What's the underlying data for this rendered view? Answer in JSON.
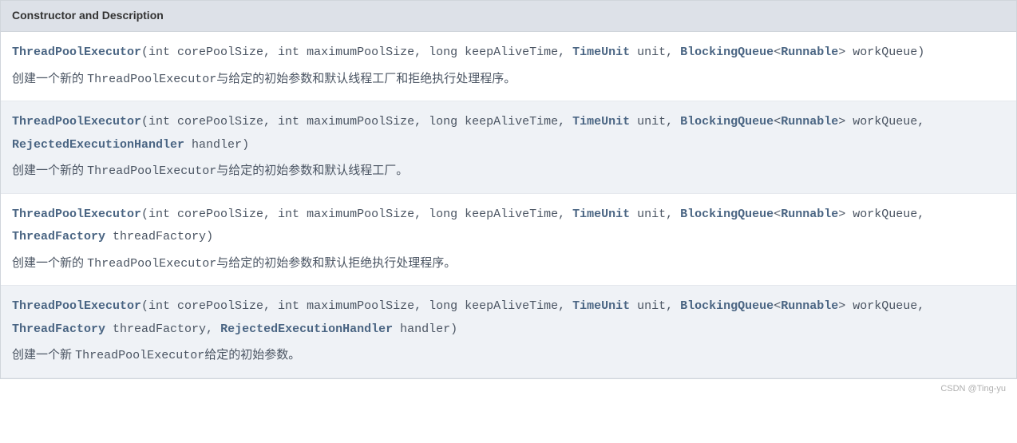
{
  "header": {
    "title": "Constructor and Description"
  },
  "rows": [
    {
      "className": "ThreadPoolExecutor",
      "sig_open": "(int corePoolSize, int maximumPoolSize, long keepAliveTime, ",
      "type1": "TimeUnit",
      "sig_mid1": " unit, ",
      "type2": "BlockingQueue",
      "lt": "<",
      "type3": "Runnable",
      "gt": "> workQueue",
      "extra1": "",
      "extraType1": "",
      "extra2": "",
      "extraType2": "",
      "extra3": "",
      "close": ")",
      "desc_pre": "创建一个新的 ",
      "desc_mono": "ThreadPoolExecutor",
      "desc_post": "与给定的初始参数和默认线程工厂和拒绝执行处理程序。"
    },
    {
      "className": "ThreadPoolExecutor",
      "sig_open": "(int corePoolSize, int maximumPoolSize, long keepAliveTime, ",
      "type1": "TimeUnit",
      "sig_mid1": " unit, ",
      "type2": "BlockingQueue",
      "lt": "<",
      "type3": "Runnable",
      "gt": "> workQueue, ",
      "extra1": "",
      "extraType1": "RejectedExecutionHandler",
      "extra2": " handler",
      "extraType2": "",
      "extra3": "",
      "close": ")",
      "desc_pre": "创建一个新的 ",
      "desc_mono": "ThreadPoolExecutor",
      "desc_post": "与给定的初始参数和默认线程工厂。"
    },
    {
      "className": "ThreadPoolExecutor",
      "sig_open": "(int corePoolSize, int maximumPoolSize, long keepAliveTime, ",
      "type1": "TimeUnit",
      "sig_mid1": " unit, ",
      "type2": "BlockingQueue",
      "lt": "<",
      "type3": "Runnable",
      "gt": "> workQueue, ",
      "extra1": "",
      "extraType1": "ThreadFactory",
      "extra2": " threadFactory",
      "extraType2": "",
      "extra3": "",
      "close": ")",
      "desc_pre": "创建一个新的 ",
      "desc_mono": "ThreadPoolExecutor",
      "desc_post": "与给定的初始参数和默认拒绝执行处理程序。"
    },
    {
      "className": "ThreadPoolExecutor",
      "sig_open": "(int corePoolSize, int maximumPoolSize, long keepAliveTime, ",
      "type1": "TimeUnit",
      "sig_mid1": " unit, ",
      "type2": "BlockingQueue",
      "lt": "<",
      "type3": "Runnable",
      "gt": "> workQueue, ",
      "extra1": "",
      "extraType1": "ThreadFactory",
      "extra2": " threadFactory, ",
      "extraType2": "RejectedExecutionHandler",
      "extra3": " handler",
      "close": ")",
      "desc_pre": "创建一个新 ",
      "desc_mono": "ThreadPoolExecutor",
      "desc_post": "给定的初始参数。"
    }
  ],
  "watermark": "CSDN @Ting-yu"
}
